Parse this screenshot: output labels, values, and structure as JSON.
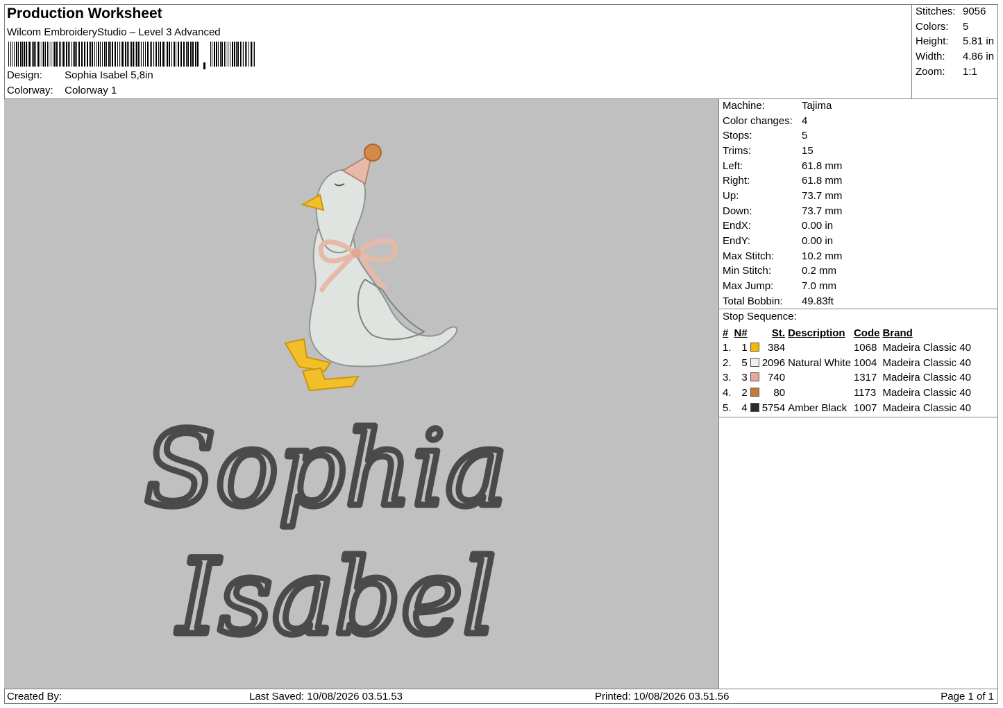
{
  "header": {
    "title": "Production Worksheet",
    "software": "Wilcom EmbroideryStudio – Level 3 Advanced",
    "design_label": "Design:",
    "design_value": "Sophia Isabel 5,8in",
    "colorway_label": "Colorway:",
    "colorway_value": "Colorway 1"
  },
  "summary": {
    "stitches_label": "Stitches:",
    "stitches_value": "9056",
    "colors_label": "Colors:",
    "colors_value": "5",
    "height_label": "Height:",
    "height_value": "5.81 in",
    "width_label": "Width:",
    "width_value": "4.86 in",
    "zoom_label": "Zoom:",
    "zoom_value": "1:1"
  },
  "machine_info": {
    "machine_label": "Machine:",
    "machine_value": "Tajima",
    "color_changes_label": "Color changes:",
    "color_changes_value": "4",
    "stops_label": "Stops:",
    "stops_value": "5",
    "trims_label": "Trims:",
    "trims_value": "15",
    "left_label": "Left:",
    "left_value": "61.8 mm",
    "right_label": "Right:",
    "right_value": "61.8 mm",
    "up_label": "Up:",
    "up_value": "73.7 mm",
    "down_label": "Down:",
    "down_value": "73.7 mm",
    "endx_label": "EndX:",
    "endx_value": "0.00 in",
    "endy_label": "EndY:",
    "endy_value": "0.00 in",
    "max_stitch_label": "Max Stitch:",
    "max_stitch_value": "10.2 mm",
    "min_stitch_label": "Min Stitch:",
    "min_stitch_value": "0.2 mm",
    "max_jump_label": "Max Jump:",
    "max_jump_value": "7.0 mm",
    "total_bobbin_label": "Total Bobbin:",
    "total_bobbin_value": "49.83ft"
  },
  "stop_sequence": {
    "caption": "Stop Sequence:",
    "headers": {
      "num": "#",
      "n": "N#",
      "st": "St.",
      "desc": "Description",
      "code": "Code",
      "brand": "Brand"
    },
    "rows": [
      {
        "num": "1.",
        "n": "1",
        "color": "#f5b800",
        "st": "384",
        "desc": "",
        "code": "1068",
        "brand": "Madeira Classic 40"
      },
      {
        "num": "2.",
        "n": "5",
        "color": "#eeeef2",
        "st": "2096",
        "desc": "Natural White",
        "code": "1004",
        "brand": "Madeira Classic 40"
      },
      {
        "num": "3.",
        "n": "3",
        "color": "#e8a79d",
        "st": "740",
        "desc": "",
        "code": "1317",
        "brand": "Madeira Classic 40"
      },
      {
        "num": "4.",
        "n": "2",
        "color": "#c47a3a",
        "st": "80",
        "desc": "",
        "code": "1173",
        "brand": "Madeira Classic 40"
      },
      {
        "num": "5.",
        "n": "4",
        "color": "#2a2a2a",
        "st": "5754",
        "desc": "Amber Black",
        "code": "1007",
        "brand": "Madeira Classic 40"
      }
    ]
  },
  "design": {
    "name_line1": "Sophia",
    "name_line2": "Isabel",
    "background": "#c0c0c0",
    "thread_text": "#4a4a48",
    "goose_body": "#dfe4e0",
    "beak_feet": "#f2be2a",
    "ribbon_hat": "#e7b9a8",
    "pompom": "#d48a4a"
  },
  "footer": {
    "created_by": "Created By:",
    "last_saved": "Last Saved: 10/08/2026 03.51.53",
    "printed": "Printed: 10/08/2026 03.51.56",
    "page": "Page 1 of 1"
  }
}
